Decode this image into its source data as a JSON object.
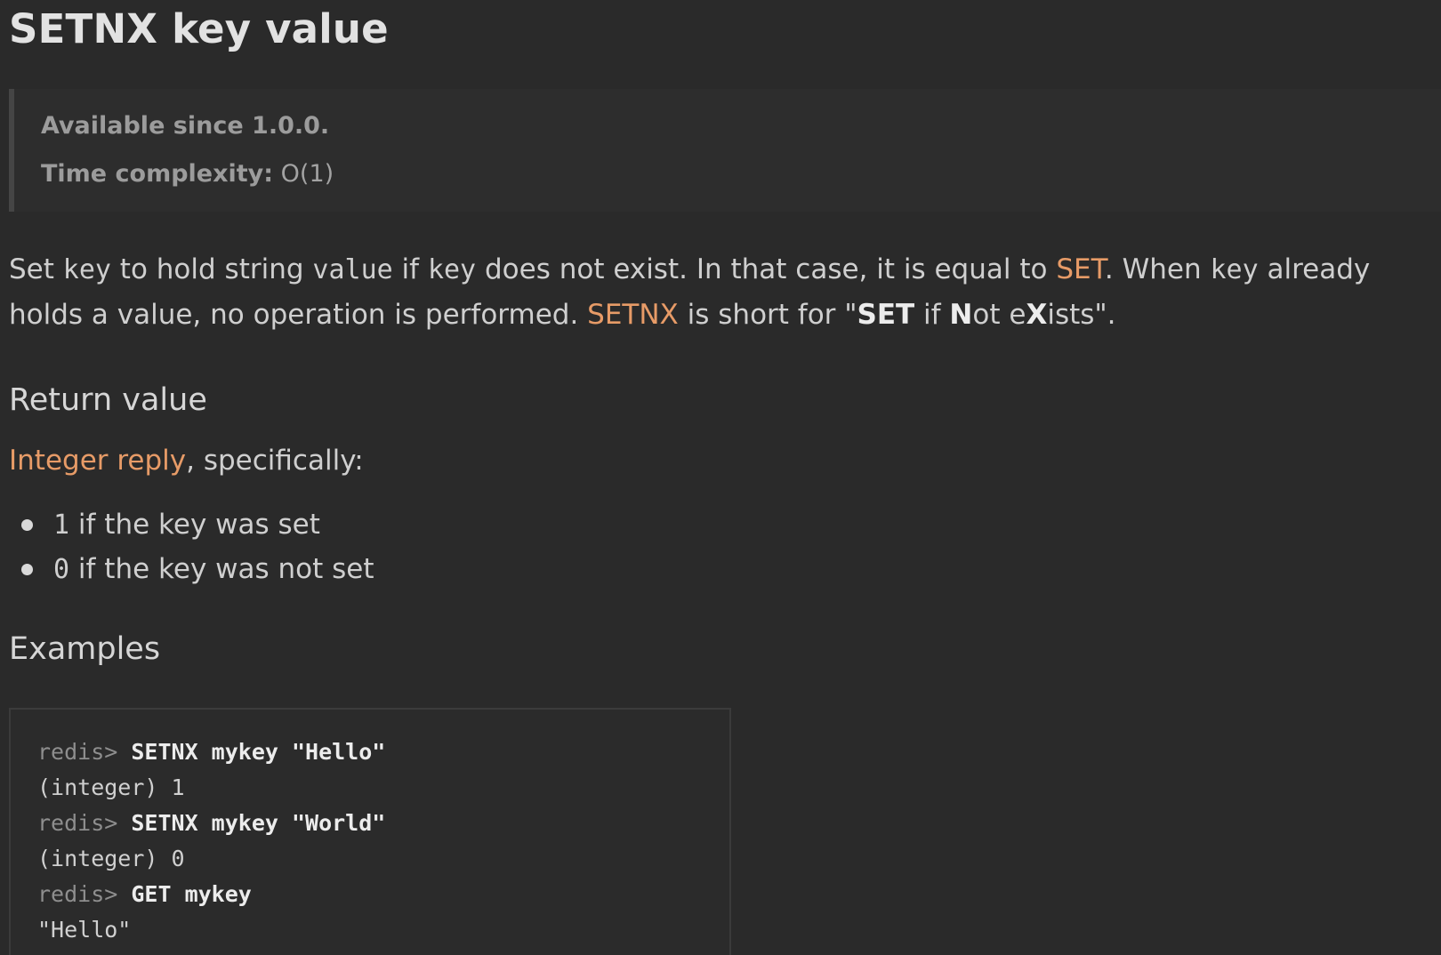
{
  "title": "SETNX key value",
  "meta": {
    "available_label": "Available since 1.0.0.",
    "complexity_label": "Time complexity:",
    "complexity_value": "O(1)"
  },
  "description": {
    "t1": "Set ",
    "key1": "key",
    "t2": " to hold string ",
    "value": "value",
    "t3": " if ",
    "key2": "key",
    "t4": " does not exist. In that case, it is equal to ",
    "set_link": "SET",
    "t5": ". When ",
    "key3": "key",
    "t6": " already holds a value, no operation is performed. ",
    "setnx_link": "SETNX",
    "t7": " is short for \"",
    "b_set": "SET",
    "t8": " if ",
    "b_n": "N",
    "t9": "ot e",
    "b_x": "X",
    "t10": "ists\"."
  },
  "return_value": {
    "heading": "Return value",
    "link": "Integer reply",
    "suffix": ", specifically:",
    "items": [
      {
        "code": "1",
        "text": " if the key was set"
      },
      {
        "code": "0",
        "text": " if the key was not set"
      }
    ]
  },
  "examples": {
    "heading": "Examples",
    "lines": [
      {
        "prompt": "redis> ",
        "cmd": "SETNX mykey \"Hello\""
      },
      {
        "output": "(integer) 1"
      },
      {
        "prompt": "redis> ",
        "cmd": "SETNX mykey \"World\""
      },
      {
        "output": "(integer) 0"
      },
      {
        "prompt": "redis> ",
        "cmd": "GET mykey"
      },
      {
        "output": "\"Hello\""
      }
    ]
  },
  "colors": {
    "background": "#2a2a2a",
    "link": "#e79b67",
    "text": "#cfcfcf"
  }
}
